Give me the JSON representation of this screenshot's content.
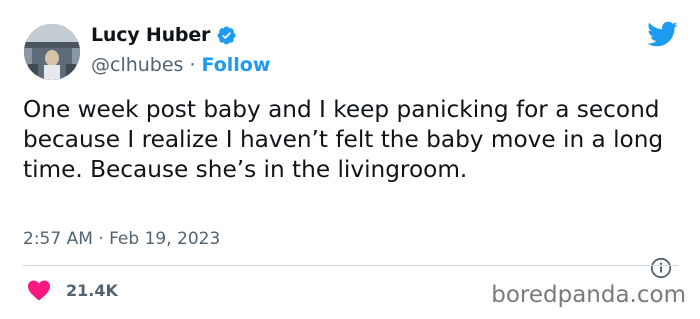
{
  "author": {
    "display_name": "Lucy Huber",
    "handle": "@clhubes",
    "separator": "·",
    "follow_label": "Follow",
    "verified_icon": "verified-badge-icon"
  },
  "tweet": {
    "text": "One week post baby and I keep panicking for a second because I realize I haven’t felt the baby move in a long time. Because she’s in the livingroom.",
    "timestamp": "2:57 AM · Feb 19, 2023"
  },
  "engagement": {
    "likes_count": "21.4K",
    "like_icon": "heart-icon"
  },
  "icons": {
    "logo": "twitter-bird-icon",
    "info": "info-icon"
  },
  "watermark": {
    "text": "boredpanda.com"
  },
  "colors": {
    "accent": "#1d9bf0",
    "heart": "#f91880",
    "secondary_text": "#536471",
    "primary_text": "#0f1419"
  }
}
